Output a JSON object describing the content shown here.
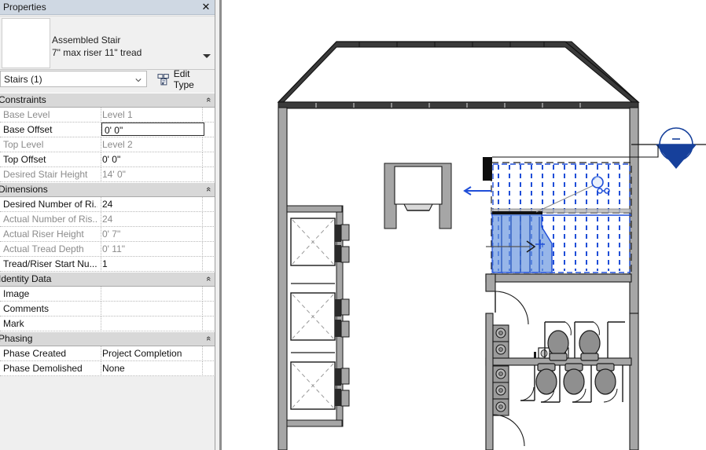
{
  "palette": {
    "title": "Properties",
    "close_label": "✕",
    "type_name_line1": "Assembled Stair",
    "type_name_line2": "7\" max riser 11\" tread",
    "selector_value": "Stairs (1)",
    "edit_type_label": "Edit Type",
    "dropdown_icon": "chevron-down-icon",
    "collapse_icon": "«"
  },
  "groups": [
    {
      "name": "Constraints",
      "rows": [
        {
          "key": "Base Level",
          "value": "Level 1",
          "readonly": true,
          "active": false
        },
        {
          "key": "Base Offset",
          "value": "0'  0\"",
          "readonly": false,
          "active": true
        },
        {
          "key": "Top Level",
          "value": "Level 2",
          "readonly": true,
          "active": false
        },
        {
          "key": "Top Offset",
          "value": "0'  0\"",
          "readonly": false,
          "active": false
        },
        {
          "key": "Desired Stair Height",
          "value": "14'  0\"",
          "readonly": true,
          "active": false
        }
      ]
    },
    {
      "name": "Dimensions",
      "rows": [
        {
          "key": "Desired Number of Ri...",
          "value": "24",
          "readonly": false,
          "active": false
        },
        {
          "key": "Actual Number of Ris...",
          "value": "24",
          "readonly": true,
          "active": false
        },
        {
          "key": "Actual Riser Height",
          "value": "0'  7\"",
          "readonly": true,
          "active": false
        },
        {
          "key": "Actual Tread Depth",
          "value": "0'  11\"",
          "readonly": true,
          "active": false
        },
        {
          "key": "Tread/Riser Start Nu...",
          "value": "1",
          "readonly": false,
          "active": false
        }
      ]
    },
    {
      "name": "Identity Data",
      "rows": [
        {
          "key": "Image",
          "value": "",
          "readonly": false,
          "active": false
        },
        {
          "key": "Comments",
          "value": "",
          "readonly": false,
          "active": false
        },
        {
          "key": "Mark",
          "value": "",
          "readonly": false,
          "active": false
        }
      ]
    },
    {
      "name": "Phasing",
      "rows": [
        {
          "key": "Phase Created",
          "value": "Project Completion",
          "readonly": false,
          "active": false
        },
        {
          "key": "Phase Demolished",
          "value": "None",
          "readonly": false,
          "active": false
        }
      ]
    }
  ],
  "canvas": {
    "description": "Architectural floor plan view with stair run selected in edit mode",
    "accent_blue": "#1f4ed8",
    "stair_fill": "#6f9ae0",
    "wall_fill": "#a6a6a6",
    "wall_stroke": "#1a1a1a",
    "section_marker": "section-head-marker",
    "elements": [
      "roof-outline",
      "elevator-shafts",
      "utility-closet",
      "stair-run-selected",
      "restroom-fixtures",
      "section-marker"
    ]
  }
}
